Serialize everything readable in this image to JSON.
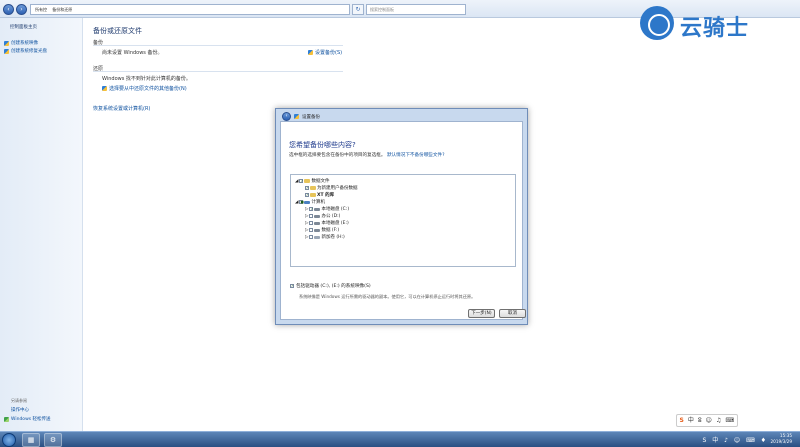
{
  "address": {
    "crumbs": [
      "所有控",
      "备份和还原",
      ""
    ],
    "search_placeholder": "搜索控制面板"
  },
  "sidebar": {
    "title": "控制面板主页",
    "links": [
      "创建系统映像",
      "创建系统修复光盘"
    ],
    "see_also_label": "另请参阅",
    "bottom_links": [
      "操作中心",
      "Windows 轻松传送"
    ]
  },
  "main": {
    "title": "备份或还原文件",
    "backup_section": "备份",
    "backup_status": "尚未设置 Windows 备份。",
    "setup_backup_link": "设置备份(S)",
    "restore_section": "还原",
    "restore_status": "Windows 找不到针对此计算机的备份。",
    "restore_link": "选择要从中还原文件的其他备份(N)",
    "recover_link": "恢复系统设置或计算机(R)"
  },
  "watermark": {
    "text": "云骑士"
  },
  "dialog": {
    "caption": "设置备份",
    "heading": "您希望备份哪些内容?",
    "subtitle": "选中框的选择要包含在备份中的项目的复选框。",
    "subtitle_link": "默认情况下不备份哪些文件?",
    "tree": [
      {
        "label": "数据文件",
        "checked": true
      },
      {
        "label": "为新建用户备份数据",
        "checked": true
      },
      {
        "label": "XT 的库",
        "checked": true
      },
      {
        "label": "计算机",
        "checked": false
      },
      {
        "label": "本地磁盘 (C:)",
        "checked": true
      },
      {
        "label": "办公 (D:)",
        "checked": false
      },
      {
        "label": "本地磁盘 (E:)",
        "checked": false
      },
      {
        "label": "数据 (F:)",
        "checked": false
      },
      {
        "label": "新加卷 (H:)",
        "checked": false
      }
    ],
    "system_image_label": "包括驱动器 (C:), (E:) 的系统映像(S)",
    "system_image_desc": "系统映像是 Windows 运行所需的驱动器的副本。使用它，可以在计算机停止运行时将其还原。",
    "next_button": "下一步(N)",
    "cancel_button": "取消"
  },
  "taskbar": {
    "tray_icons": "S 中 ♪ ☺ ⌨ ♦",
    "time": "15:35",
    "date": "2019/3/29"
  }
}
